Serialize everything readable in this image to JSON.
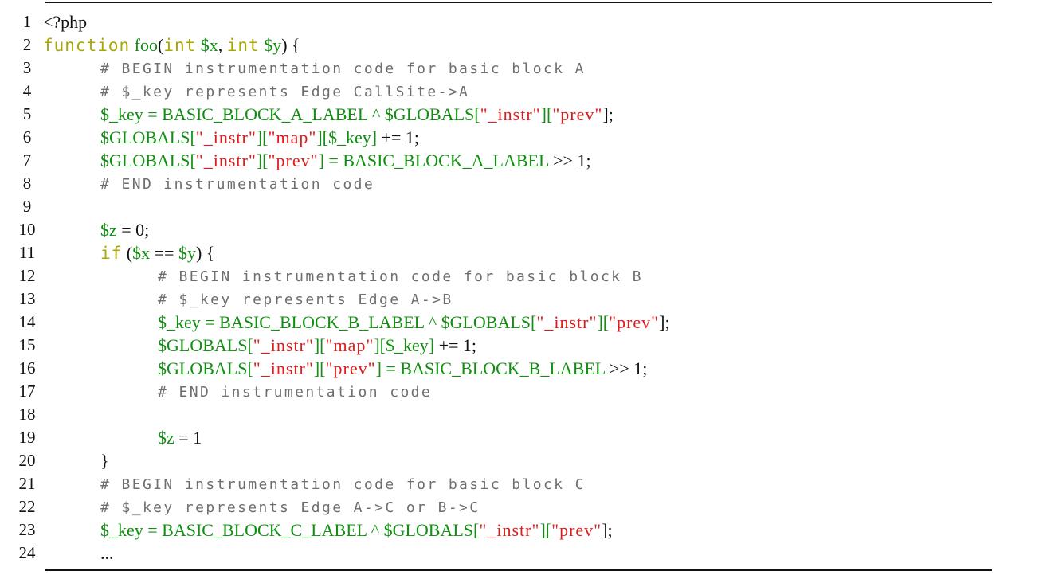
{
  "lines": [
    {
      "num": "1",
      "indent": 0,
      "tokens": [
        {
          "t": "<?php",
          "c": "plain"
        }
      ]
    },
    {
      "num": "2",
      "indent": 0,
      "tokens": [
        {
          "t": "function",
          "c": "kw"
        },
        {
          "t": " ",
          "c": "plain"
        },
        {
          "t": "foo",
          "c": "var"
        },
        {
          "t": "(",
          "c": "plain"
        },
        {
          "t": "int",
          "c": "kw"
        },
        {
          "t": " ",
          "c": "plain"
        },
        {
          "t": "$x",
          "c": "var"
        },
        {
          "t": ", ",
          "c": "plain"
        },
        {
          "t": "int",
          "c": "kw"
        },
        {
          "t": " ",
          "c": "plain"
        },
        {
          "t": "$y",
          "c": "var"
        },
        {
          "t": ") {",
          "c": "plain"
        }
      ]
    },
    {
      "num": "3",
      "indent": 1,
      "tokens": [
        {
          "t": "# BEGIN instrumentation code for basic block A",
          "c": "cmt"
        }
      ]
    },
    {
      "num": "4",
      "indent": 1,
      "tokens": [
        {
          "t": "# $_key represents Edge CallSite->A",
          "c": "cmt"
        }
      ]
    },
    {
      "num": "5",
      "indent": 1,
      "tokens": [
        {
          "t": "$_key = BASIC_BLOCK_A_LABEL ^ $GLOBALS[",
          "c": "var"
        },
        {
          "t": "\"_instr\"",
          "c": "str"
        },
        {
          "t": "][",
          "c": "var"
        },
        {
          "t": "\"prev\"",
          "c": "str"
        },
        {
          "t": "];",
          "c": "plain"
        }
      ]
    },
    {
      "num": "6",
      "indent": 1,
      "tokens": [
        {
          "t": "$GLOBALS[",
          "c": "var"
        },
        {
          "t": "\"_instr\"",
          "c": "str"
        },
        {
          "t": "][",
          "c": "var"
        },
        {
          "t": "\"map\"",
          "c": "str"
        },
        {
          "t": "][$_key]",
          "c": "var"
        },
        {
          "t": " += 1;",
          "c": "plain"
        }
      ]
    },
    {
      "num": "7",
      "indent": 1,
      "tokens": [
        {
          "t": "$GLOBALS[",
          "c": "var"
        },
        {
          "t": "\"_instr\"",
          "c": "str"
        },
        {
          "t": "][",
          "c": "var"
        },
        {
          "t": "\"prev\"",
          "c": "str"
        },
        {
          "t": "] = BASIC_BLOCK_A_LABEL",
          "c": "var"
        },
        {
          "t": " >> 1;",
          "c": "plain"
        }
      ]
    },
    {
      "num": "8",
      "indent": 1,
      "tokens": [
        {
          "t": "# END instrumentation code",
          "c": "cmt"
        }
      ]
    },
    {
      "num": "9",
      "indent": 0,
      "tokens": []
    },
    {
      "num": "10",
      "indent": 1,
      "tokens": [
        {
          "t": "$z",
          "c": "var"
        },
        {
          "t": " = 0;",
          "c": "plain"
        }
      ]
    },
    {
      "num": "11",
      "indent": 1,
      "tokens": [
        {
          "t": "if",
          "c": "kw"
        },
        {
          "t": " (",
          "c": "plain"
        },
        {
          "t": "$x",
          "c": "var"
        },
        {
          "t": " == ",
          "c": "plain"
        },
        {
          "t": "$y",
          "c": "var"
        },
        {
          "t": ") {",
          "c": "plain"
        }
      ]
    },
    {
      "num": "12",
      "indent": 2,
      "tokens": [
        {
          "t": "# BEGIN instrumentation code for basic block B",
          "c": "cmt"
        }
      ]
    },
    {
      "num": "13",
      "indent": 2,
      "tokens": [
        {
          "t": "# $_key represents Edge A->B",
          "c": "cmt"
        }
      ]
    },
    {
      "num": "14",
      "indent": 2,
      "tokens": [
        {
          "t": "$_key = BASIC_BLOCK_B_LABEL ^ $GLOBALS[",
          "c": "var"
        },
        {
          "t": "\"_instr\"",
          "c": "str"
        },
        {
          "t": "][",
          "c": "var"
        },
        {
          "t": "\"prev\"",
          "c": "str"
        },
        {
          "t": "];",
          "c": "plain"
        }
      ]
    },
    {
      "num": "15",
      "indent": 2,
      "tokens": [
        {
          "t": "$GLOBALS[",
          "c": "var"
        },
        {
          "t": "\"_instr\"",
          "c": "str"
        },
        {
          "t": "][",
          "c": "var"
        },
        {
          "t": "\"map\"",
          "c": "str"
        },
        {
          "t": "][$_key]",
          "c": "var"
        },
        {
          "t": " += 1;",
          "c": "plain"
        }
      ]
    },
    {
      "num": "16",
      "indent": 2,
      "tokens": [
        {
          "t": "$GLOBALS[",
          "c": "var"
        },
        {
          "t": "\"_instr\"",
          "c": "str"
        },
        {
          "t": "][",
          "c": "var"
        },
        {
          "t": "\"prev\"",
          "c": "str"
        },
        {
          "t": "] = BASIC_BLOCK_B_LABEL",
          "c": "var"
        },
        {
          "t": " >> 1;",
          "c": "plain"
        }
      ]
    },
    {
      "num": "17",
      "indent": 2,
      "tokens": [
        {
          "t": "# END instrumentation code",
          "c": "cmt"
        }
      ]
    },
    {
      "num": "18",
      "indent": 0,
      "tokens": []
    },
    {
      "num": "19",
      "indent": 2,
      "tokens": [
        {
          "t": "$z",
          "c": "var"
        },
        {
          "t": " = 1",
          "c": "plain"
        }
      ]
    },
    {
      "num": "20",
      "indent": 1,
      "tokens": [
        {
          "t": "}",
          "c": "plain"
        }
      ]
    },
    {
      "num": "21",
      "indent": 1,
      "tokens": [
        {
          "t": "# BEGIN instrumentation code for basic block C",
          "c": "cmt"
        }
      ]
    },
    {
      "num": "22",
      "indent": 1,
      "tokens": [
        {
          "t": "# $_key represents Edge A->C or B->C",
          "c": "cmt"
        }
      ]
    },
    {
      "num": "23",
      "indent": 1,
      "tokens": [
        {
          "t": "$_key = BASIC_BLOCK_C_LABEL ^ $GLOBALS[",
          "c": "var"
        },
        {
          "t": "\"_instr\"",
          "c": "str"
        },
        {
          "t": "][",
          "c": "var"
        },
        {
          "t": "\"prev\"",
          "c": "str"
        },
        {
          "t": "];",
          "c": "plain"
        }
      ]
    },
    {
      "num": "24",
      "indent": 1,
      "tokens": [
        {
          "t": "...",
          "c": "plain"
        }
      ]
    }
  ],
  "colors": {
    "keyword": "#a8a800",
    "comment": "#6e6e6e",
    "variable": "#118f11",
    "string": "#e01b1b",
    "plain": "#111111"
  }
}
